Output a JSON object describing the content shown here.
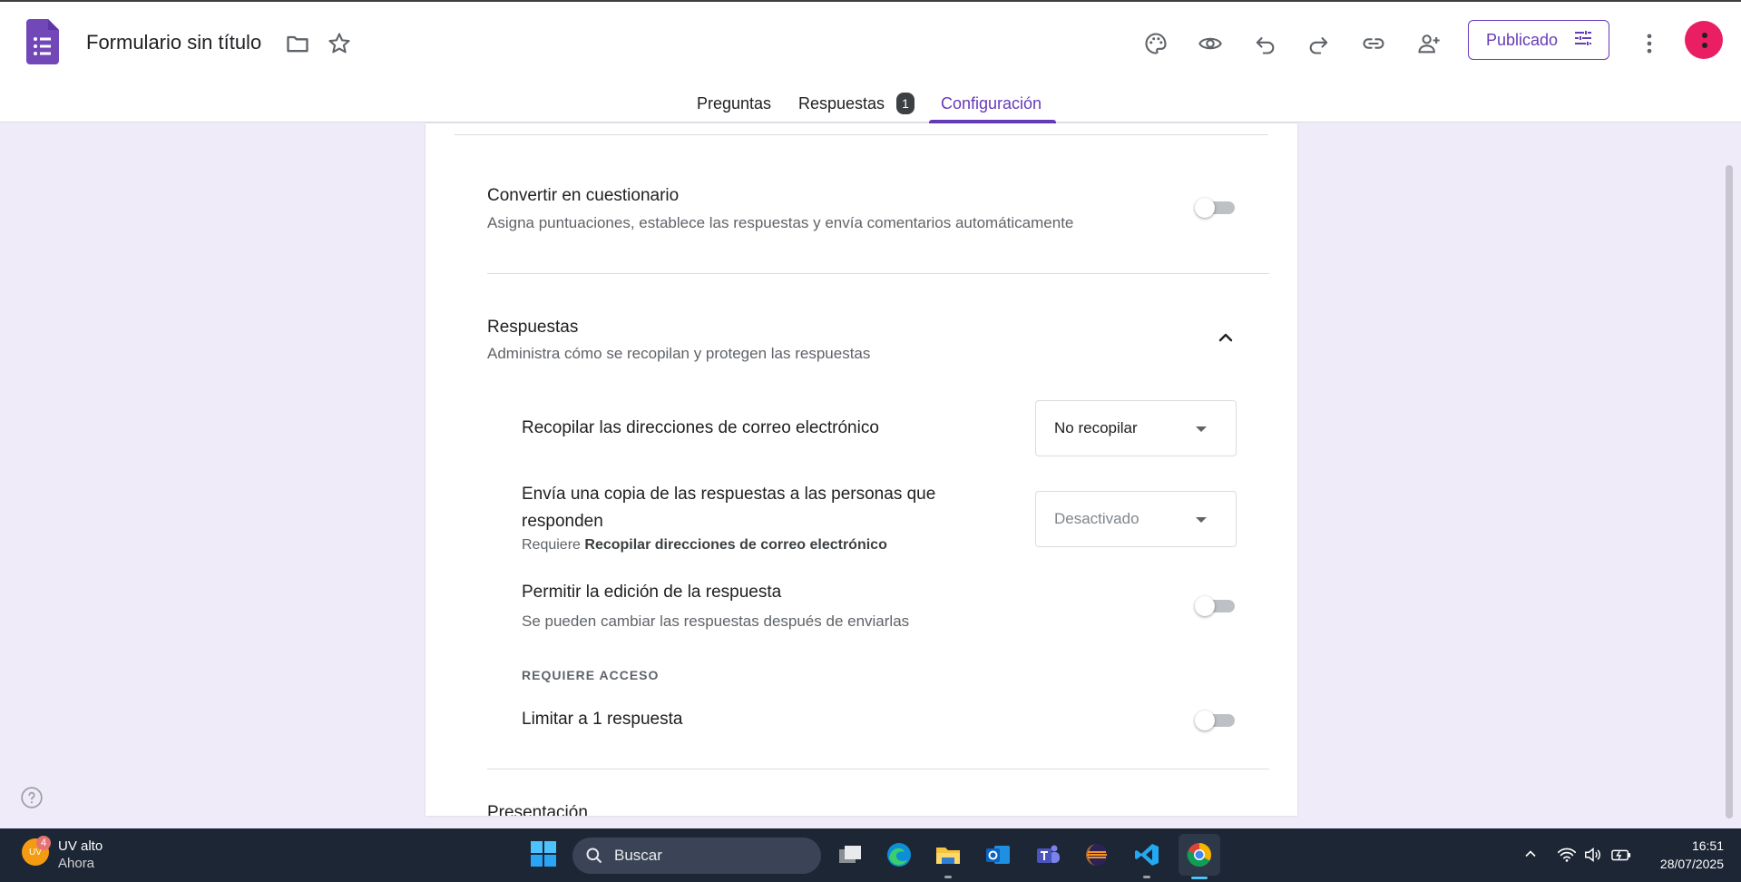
{
  "header": {
    "doc_title": "Formulario sin título",
    "publish_label": "Publicado",
    "accent_color": "#673ab7",
    "icons": [
      "palette-icon",
      "preview-icon",
      "undo-icon",
      "redo-icon",
      "link-icon",
      "add-collaborator-icon",
      "more-vert-icon"
    ]
  },
  "tabs": {
    "questions": "Preguntas",
    "responses": "Respuestas",
    "responses_badge": "1",
    "settings": "Configuración",
    "active": "settings"
  },
  "settings": {
    "quiz": {
      "title": "Convertir en cuestionario",
      "description": "Asigna puntuaciones, establece las respuestas y envía comentarios automáticamente",
      "enabled": false
    },
    "responses": {
      "title": "Respuestas",
      "description": "Administra cómo se recopilan y protegen las respuestas",
      "expanded": true,
      "collect_emails": {
        "label": "Recopilar las direcciones de correo electrónico",
        "value": "No recopilar"
      },
      "send_copy": {
        "label": "Envía una copia de las respuestas a las personas que responden",
        "requires_prefix": "Requiere",
        "requires_bold": "Recopilar direcciones de correo electrónico",
        "value": "Desactivado"
      },
      "allow_edit": {
        "label": "Permitir la edición de la respuesta",
        "description": "Se pueden cambiar las respuestas después de enviarlas",
        "enabled": false
      },
      "requires_access_heading": "REQUIERE ACCESO",
      "limit_one": {
        "label": "Limitar a 1 respuesta",
        "enabled": false
      }
    },
    "presentation_partial": "Presentación"
  },
  "taskbar": {
    "weather_title": "UV alto",
    "weather_sub": "Ahora",
    "weather_badge": "4",
    "weather_icon_text": "UV",
    "search_placeholder": "Buscar",
    "time": "16:51",
    "date": "28/07/2025"
  }
}
